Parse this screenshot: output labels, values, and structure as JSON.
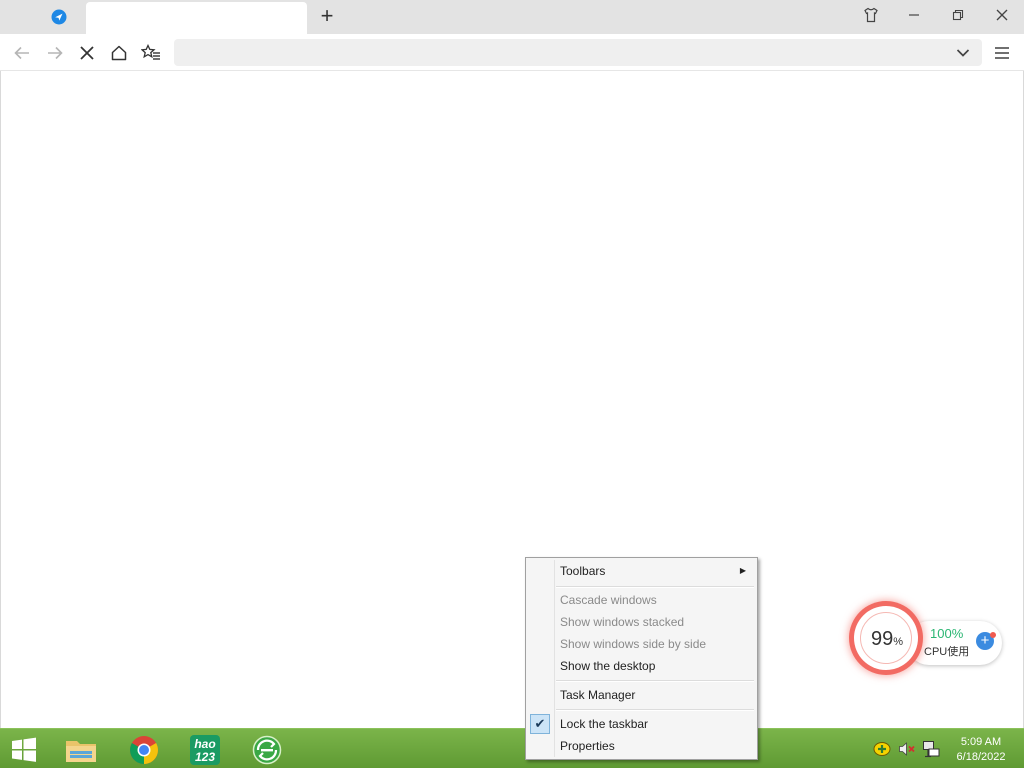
{
  "browser": {
    "active_tab_title": "",
    "new_tab_symbol": "+",
    "address_value": "",
    "address_placeholder": ""
  },
  "context_menu": {
    "toolbars": "Toolbars",
    "cascade": "Cascade windows",
    "stacked": "Show windows stacked",
    "side_by_side": "Show windows side by side",
    "show_desktop": "Show the desktop",
    "task_manager": "Task Manager",
    "lock_taskbar": "Lock the taskbar",
    "lock_checked": "✔",
    "properties": "Properties"
  },
  "cpu_widget": {
    "percent": "99",
    "percent_sign": "%",
    "usage": "100%",
    "label": "CPU使用",
    "plus": "+"
  },
  "taskbar": {
    "apps": [
      "start-button",
      "file-explorer",
      "chrome",
      "hao123",
      "360-browser"
    ],
    "hao_text_1": "hao",
    "hao_text_2": "123",
    "time": "5:09 AM",
    "date": "6/18/2022"
  },
  "colors": {
    "taskbar": "#6aa63b",
    "tab_bar": "#e3e3e3",
    "cpu_ring": "#f26b63",
    "cpu_usage": "#2bb673",
    "menu_check_bg": "#cce4f7"
  }
}
